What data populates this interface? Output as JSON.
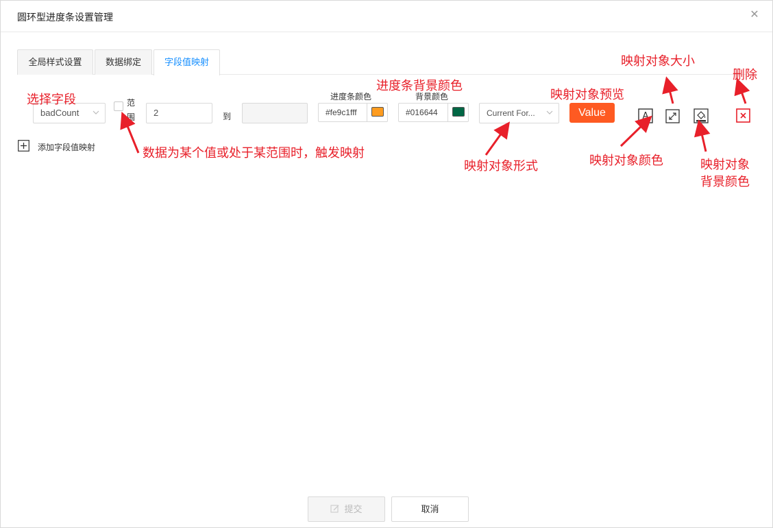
{
  "dialog": {
    "title": "圆环型进度条设置管理",
    "close_glyph": "✕"
  },
  "tabs": [
    {
      "label": "全局样式设置"
    },
    {
      "label": "数据绑定"
    },
    {
      "label": "字段值映射"
    }
  ],
  "mapping_row": {
    "field_value": "badCount",
    "range_label_1": "范",
    "range_label_2": "围",
    "from_value": "2",
    "to_label": "到",
    "to_value": "",
    "bar_color_label": "进度条颜色",
    "bar_color_value": "#fe9c1fff",
    "bar_color_swatch": "#fe9c1f",
    "bg_color_label": "背景颜色",
    "bg_color_value": "#016644",
    "bg_color_swatch": "#016644",
    "form_value": "Current For...",
    "preview_text": "Value",
    "font_color_icon_letter": "A",
    "delete_glyph": "×"
  },
  "add_mapping_label": "添加字段值映射",
  "annotations": {
    "select_field": "选择字段",
    "bar_bg_color": "进度条背景颜色",
    "preview": "映射对象预览",
    "size": "映射对象大小",
    "delete": "删除",
    "range_trigger": "数据为某个值或处于某范围时，触发映射",
    "form": "映射对象形式",
    "font_color": "映射对象颜色",
    "bg_color_1": "映射对象",
    "bg_color_2": "背景颜色"
  },
  "footer": {
    "submit_label": "提交",
    "cancel_label": "取消"
  },
  "colors": {
    "accent": "#1890ff",
    "annotation": "#e8202a",
    "preview_bg": "#fe5a22"
  }
}
